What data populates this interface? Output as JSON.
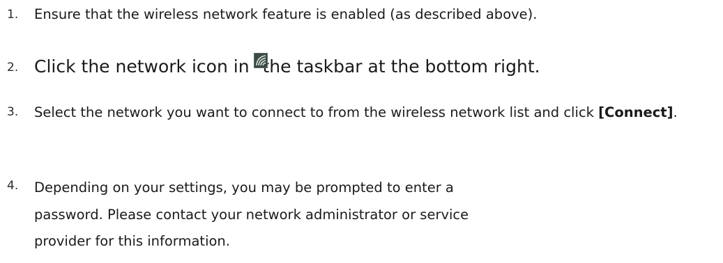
{
  "steps": [
    {
      "number": "1.",
      "text": "Ensure that the wireless network feature is enabled (as described above)."
    },
    {
      "number": "2.",
      "text_before_icon": "Click the network icon in ",
      "icon": "wireless-network-icon",
      "text_after_icon": "the taskbar at the bottom right."
    },
    {
      "number": "3.",
      "text": "Select the network you want to connect to from the wireless network list and click ",
      "bold": "[Connect]",
      "text_end": "."
    },
    {
      "number": "4.",
      "lines": [
        "Depending on your settings, you may be prompted to enter a",
        "password. Please contact your network administrator or service",
        "provider for this information."
      ]
    }
  ],
  "colors": {
    "text": "#1a1a1a",
    "icon_bg": "#3b4a44",
    "icon_wave": "#d9e6df"
  }
}
